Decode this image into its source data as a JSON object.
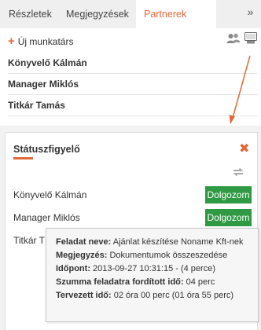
{
  "tabs": {
    "items": [
      {
        "label": "Részletek"
      },
      {
        "label": "Megjegyzések"
      },
      {
        "label": "Partnerek"
      }
    ],
    "more": "»"
  },
  "partners": {
    "add_label": "Új munkatárs",
    "add_icon": "plus-icon",
    "view_icons": [
      "users-icon",
      "monitor-icon"
    ],
    "people": [
      "Könyvelő Kálmán",
      "Manager Miklós",
      "Titkár Tamás"
    ]
  },
  "status_widget": {
    "title": "Státuszfigyelő",
    "close": "✖",
    "refresh_icon": "refresh-icon",
    "rows": [
      {
        "name": "Könyvelő Kálmán",
        "status": "Dolgozom"
      },
      {
        "name": "Manager Miklós",
        "status": "Dolgozom"
      },
      {
        "name": "Titkár T",
        "status": ""
      }
    ]
  },
  "tooltip": {
    "task_label": "Feladat neve:",
    "task_value": "Ajánlat készítése Noname Kft-nek",
    "note_label": "Megjegyzés:",
    "note_value": "Dokumentumok összeszedése",
    "time_label": "Időpont:",
    "time_value": "2013-09-27 10:31:15 - (4 perce)",
    "sum_label": "Szumma feladatra fordított idő:",
    "sum_value": "04 perc",
    "planned_label": "Tervezett idő:",
    "planned_value": "02 óra 00 perc (01 óra 55 perc)"
  },
  "colors": {
    "accent": "#e2683a",
    "status_green": "#2f9a43"
  }
}
